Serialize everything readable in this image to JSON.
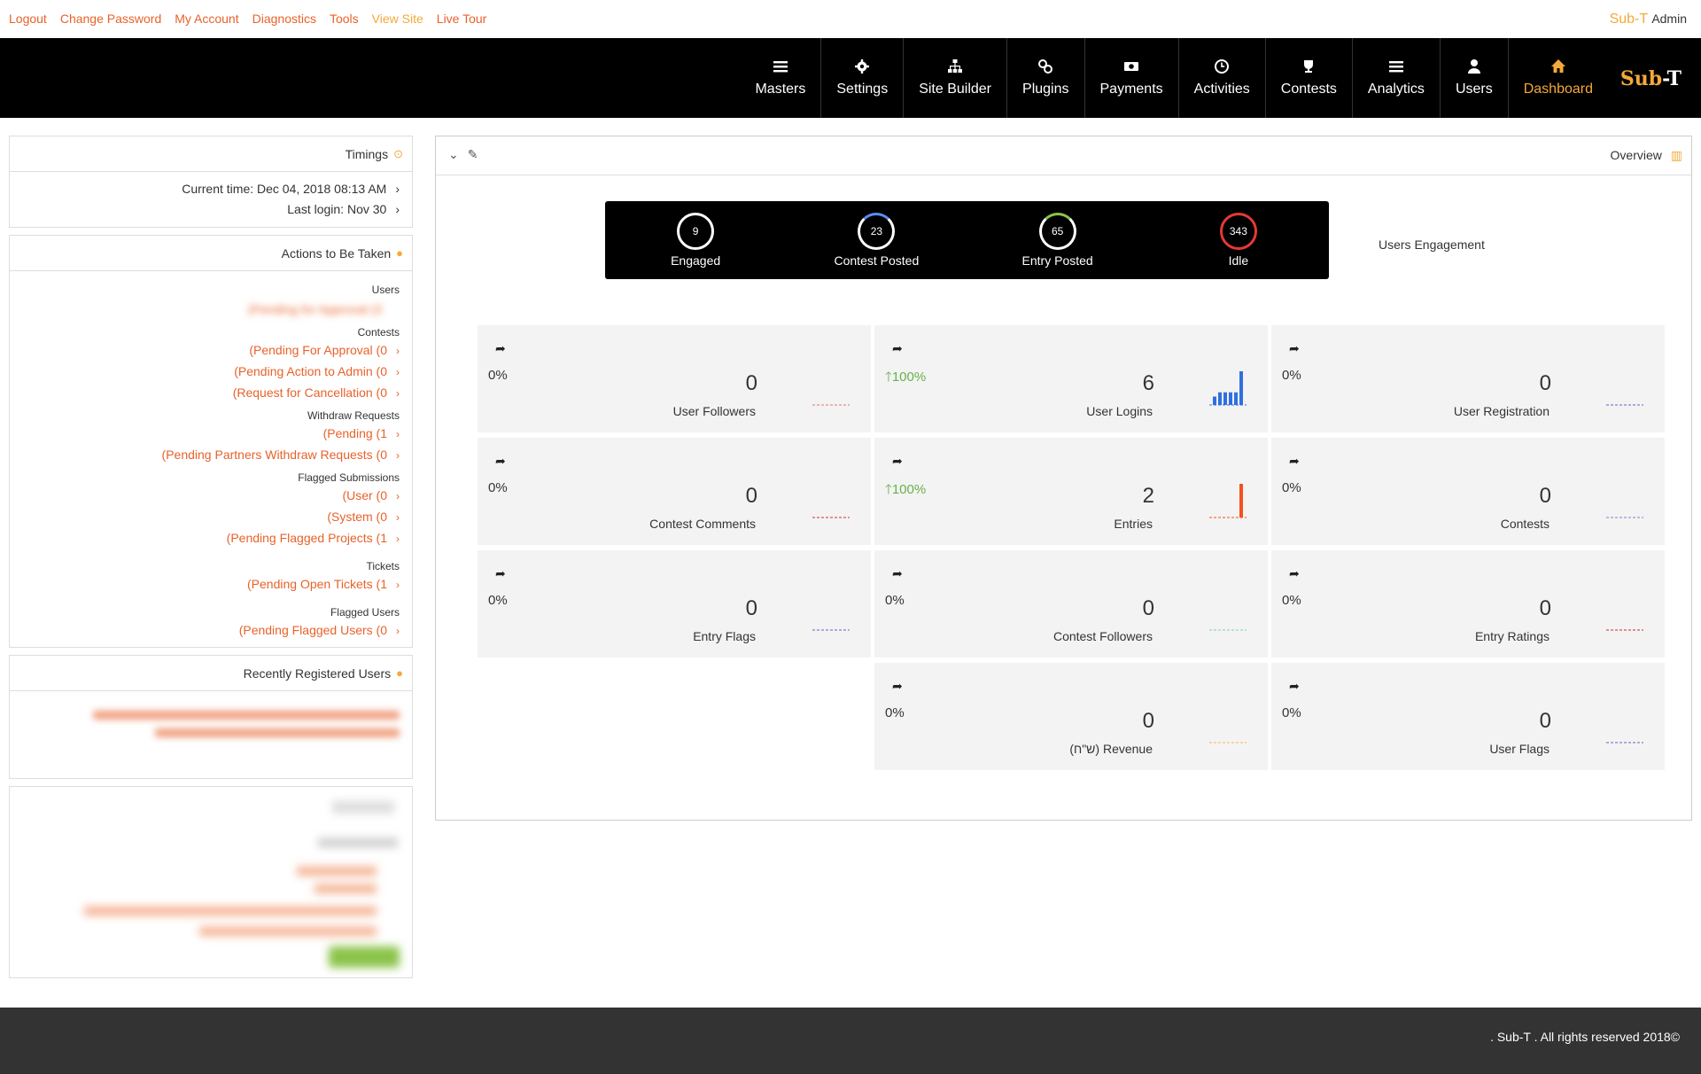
{
  "toplinks": [
    "Logout",
    "Change Password",
    "My Account",
    "Diagnostics",
    "Tools",
    "View Site",
    "Live Tour"
  ],
  "brand": {
    "name": "Sub-T",
    "role": "Admin"
  },
  "nav": [
    {
      "label": "Masters",
      "icon": "list-icon"
    },
    {
      "label": "Settings",
      "icon": "gear-icon"
    },
    {
      "label": "Site Builder",
      "icon": "sitemap-icon"
    },
    {
      "label": "Plugins",
      "icon": "link-icon"
    },
    {
      "label": "Payments",
      "icon": "money-icon"
    },
    {
      "label": "Activities",
      "icon": "clock-icon"
    },
    {
      "label": "Contests",
      "icon": "trophy-icon"
    },
    {
      "label": "Analytics",
      "icon": "list-icon"
    },
    {
      "label": "Users",
      "icon": "user-icon"
    },
    {
      "label": "Dashboard",
      "icon": "home-icon",
      "active": true
    }
  ],
  "navbrand": {
    "a": "Sub",
    "sep": "-",
    "b": "T"
  },
  "timings": {
    "title": "Timings",
    "current": "Current time: Dec 04, 2018 08:13 AM",
    "last": "Last login: Nov 30"
  },
  "actions": {
    "title": "Actions to Be Taken",
    "users_label": "Users",
    "users_blur": "(Pending for Approval (3",
    "contests_label": "Contests",
    "contests": [
      "(Pending For Approval (0",
      "(Pending Action to Admin (0",
      "(Request for Cancellation (0"
    ],
    "withdraw_label": "Withdraw Requests",
    "withdraw": [
      "(Pending (1",
      "(Pending Partners Withdraw Requests (0"
    ],
    "flagged_label": "Flagged Submissions",
    "flagged": [
      "(User (0",
      "(System (0",
      "(Pending Flagged Projects (1"
    ],
    "tickets_label": "Tickets",
    "tickets": [
      "(Pending Open Tickets (1"
    ],
    "flagged_users_label": "Flagged Users",
    "flagged_users": [
      "(Pending Flagged Users (0"
    ]
  },
  "recent": {
    "title": "Recently Registered Users"
  },
  "overview": {
    "title": "Overview"
  },
  "engagement": {
    "label": "Users Engagement",
    "items": [
      {
        "value": "9",
        "label": "Engaged"
      },
      {
        "value": "23",
        "label": "Contest Posted"
      },
      {
        "value": "65",
        "label": "Entry Posted"
      },
      {
        "value": "343",
        "label": "Idle"
      }
    ]
  },
  "cards": [
    {
      "pct": "0%",
      "value": "0",
      "label": "User Followers",
      "up": false,
      "color": "#e57373"
    },
    {
      "pct": "100%",
      "value": "6",
      "label": "User Logins",
      "up": true,
      "color": "#2f6fe0"
    },
    {
      "pct": "0%",
      "value": "0",
      "label": "User Registration",
      "up": false,
      "color": "#7e57c2"
    },
    {
      "pct": "0%",
      "value": "0",
      "label": "Contest Comments",
      "up": false,
      "color": "#d32f2f"
    },
    {
      "pct": "100%",
      "value": "2",
      "label": "Entries",
      "up": true,
      "color": "#f4511e"
    },
    {
      "pct": "0%",
      "value": "0",
      "label": "Contests",
      "up": false,
      "color": "#9575cd"
    },
    {
      "pct": "0%",
      "value": "0",
      "label": "Entry Flags",
      "up": false,
      "color": "#7e57c2"
    },
    {
      "pct": "0%",
      "value": "0",
      "label": "Contest Followers",
      "up": false,
      "color": "#80cbc4"
    },
    {
      "pct": "0%",
      "value": "0",
      "label": "Entry Ratings",
      "up": false,
      "color": "#c62828"
    },
    {
      "pct": "0%",
      "value": "0",
      "label": "(ש\"ח) Revenue",
      "up": false,
      "color": "#ffb74d"
    },
    {
      "pct": "0%",
      "value": "0",
      "label": "User Flags",
      "up": false,
      "color": "#7e57c2"
    }
  ],
  "spark_logins": [
    2,
    3,
    3,
    3,
    3,
    8
  ],
  "spark_entries": [
    10
  ],
  "footer": ".  Sub-T  . All rights reserved 2018©"
}
